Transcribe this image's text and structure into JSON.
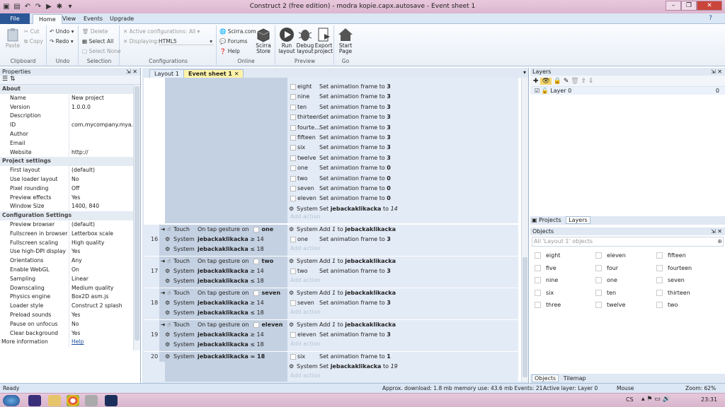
{
  "window": {
    "title": "Construct 2  (free edition) - modra kopie.capx.autosave - Event sheet 1"
  },
  "ribbon": {
    "tabs": [
      "File",
      "Home",
      "View",
      "Events",
      "Upgrade"
    ],
    "clipboard": {
      "paste": "Paste",
      "cut": "Cut",
      "copy": "Copy",
      "label": "Clipboard"
    },
    "undo": {
      "undo": "Undo",
      "redo": "Redo",
      "label": "Undo"
    },
    "selection": {
      "delete": "Delete",
      "select_all": "Select All",
      "select_none": "Select None",
      "label": "Selection"
    },
    "configurations": {
      "active": "Active configurations: All",
      "displaying": "Displaying:",
      "displaying_value": "HTML5",
      "label": "Configurations"
    },
    "online": {
      "scirra": "Scirra.com",
      "forums": "Forums",
      "help": "Help",
      "store": "Scirra Store",
      "label": "Online"
    },
    "preview": {
      "run": "Run layout",
      "debug": "Debug layout",
      "export": "Export project",
      "label": "Preview"
    },
    "go": {
      "start": "Start Page",
      "label": "Go"
    }
  },
  "properties": {
    "title": "Properties",
    "sections": [
      {
        "name": "About",
        "rows": [
          [
            "Name",
            "New project"
          ],
          [
            "Version",
            "1.0.0.0"
          ],
          [
            "Description",
            ""
          ],
          [
            "ID",
            "com.mycompany.mya..."
          ],
          [
            "Author",
            ""
          ],
          [
            "Email",
            ""
          ],
          [
            "Website",
            "http://"
          ]
        ]
      },
      {
        "name": "Project settings",
        "rows": [
          [
            "First layout",
            "(default)"
          ],
          [
            "Use loader layout",
            "No"
          ],
          [
            "Pixel rounding",
            "Off"
          ],
          [
            "Preview effects",
            "Yes"
          ],
          [
            "Window Size",
            "1400, 840"
          ]
        ]
      },
      {
        "name": "Configuration Settings",
        "rows": [
          [
            "Preview browser",
            "(default)"
          ],
          [
            "Fullscreen in browser",
            "Letterbox scale"
          ],
          [
            "Fullscreen scaling",
            "High quality"
          ],
          [
            "Use high-DPI display",
            "Yes"
          ],
          [
            "Orientations",
            "Any"
          ],
          [
            "Enable WebGL",
            "On"
          ],
          [
            "Sampling",
            "Linear"
          ],
          [
            "Downscaling",
            "Medium quality"
          ],
          [
            "Physics engine",
            "Box2D asm.js"
          ],
          [
            "Loader style",
            "Construct 2 splash"
          ],
          [
            "Preload sounds",
            "Yes"
          ],
          [
            "Pause on unfocus",
            "No"
          ],
          [
            "Clear background",
            "Yes"
          ]
        ]
      }
    ],
    "more_info": "More information",
    "help_link": "Help"
  },
  "doc_tabs": [
    "Layout 1",
    "Event sheet 1"
  ],
  "top_actions": [
    [
      "eight",
      "Set animation frame to",
      "3"
    ],
    [
      "nine",
      "Set animation frame to",
      "3"
    ],
    [
      "ten",
      "Set animation frame to",
      "3"
    ],
    [
      "thirteen",
      "Set animation frame to",
      "3"
    ],
    [
      "fourte...",
      "Set animation frame to",
      "3"
    ],
    [
      "fifteen",
      "Set animation frame to",
      "3"
    ],
    [
      "six",
      "Set animation frame to",
      "3"
    ],
    [
      "twelve",
      "Set animation frame to",
      "3"
    ],
    [
      "one",
      "Set animation frame to",
      "0"
    ],
    [
      "two",
      "Set animation frame to",
      "0"
    ],
    [
      "seven",
      "Set animation frame to",
      "0"
    ],
    [
      "eleven",
      "Set animation frame to",
      "0"
    ]
  ],
  "top_system": {
    "obj": "System",
    "act": "Set",
    "var": "jebackaklikacka",
    "to": "to",
    "val": "14"
  },
  "add_action": "Add action",
  "events": [
    {
      "num": "16",
      "obj": "one",
      "n": "one"
    },
    {
      "num": "17",
      "obj": "two",
      "n": "two"
    },
    {
      "num": "18",
      "obj": "seven",
      "n": "seven"
    },
    {
      "num": "19",
      "obj": "eleven",
      "n": "eleven"
    }
  ],
  "ev_text": {
    "touch": "Touch",
    "system": "System",
    "on_tap": "On tap gesture on",
    "var": "jebackaklikacka",
    "ge": "≥ 14",
    "le": "≤ 18",
    "add": "Add",
    "one": "1",
    "to": "to",
    "set_frame": "Set animation frame to",
    "three": "3"
  },
  "event20": {
    "num": "20",
    "cond": "jebackaklikacka = 18",
    "a1_obj": "six",
    "a1": "Set animation frame to",
    "a1_val": "1",
    "a2_act": "Set",
    "a2_var": "jebackaklikacka",
    "a2_to": "to",
    "a2_val": "19"
  },
  "layers": {
    "title": "Layers",
    "layer": "Layer 0",
    "count": "0",
    "tabs": [
      "Projects",
      "Layers"
    ]
  },
  "objects": {
    "title": "Objects",
    "filter": "All 'Layout 1' objects",
    "items": [
      "eight",
      "eleven",
      "fifteen",
      "five",
      "four",
      "fourteen",
      "nine",
      "one",
      "seven",
      "six",
      "ten",
      "thirteen",
      "three",
      "twelve",
      "two"
    ],
    "tabs": [
      "Objects",
      "Tilemap"
    ]
  },
  "status": {
    "ready": "Ready",
    "download": "Approx. download: 1.8 mb  memory use: 43.6 mb  Events: 21",
    "layer": "Active layer: Layer 0",
    "mouse": "Mouse",
    "zoom": "Zoom: 62%"
  },
  "taskbar": {
    "lang": "CS",
    "time": "23:31"
  }
}
